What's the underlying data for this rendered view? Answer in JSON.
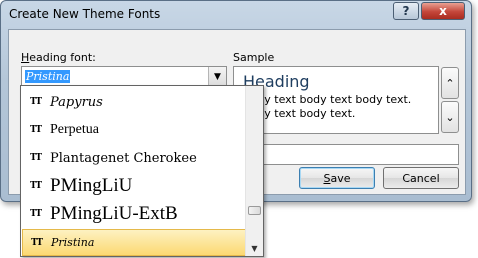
{
  "dialog": {
    "title": "Create New Theme Fonts",
    "help_label": "?",
    "close_label": "x"
  },
  "heading_font": {
    "label_accel": "H",
    "label_rest": "eading font:",
    "value": "Pristina"
  },
  "sample": {
    "label": "Sample",
    "heading": "Heading",
    "body_line1": "Body text body text body text.",
    "body_line2": "Body text body text."
  },
  "buttons": {
    "save_accel": "S",
    "save_rest": "ave",
    "cancel": "Cancel"
  },
  "font_list": {
    "items": [
      {
        "name": "Papyrus",
        "selected": false
      },
      {
        "name": "Perpetua",
        "selected": false
      },
      {
        "name": "Plantagenet Cherokee",
        "selected": false
      },
      {
        "name": "PMingLiU",
        "selected": false
      },
      {
        "name": "PMingLiU-ExtB",
        "selected": false
      },
      {
        "name": "Pristina",
        "selected": true
      }
    ],
    "selection_color": "#fcd972"
  },
  "icons": {
    "truetype": "TT",
    "dropdown_arrow": "▼",
    "scroll_up": "▲",
    "scroll_down": "▼",
    "sample_up": "⌃",
    "sample_down": "⌄"
  }
}
